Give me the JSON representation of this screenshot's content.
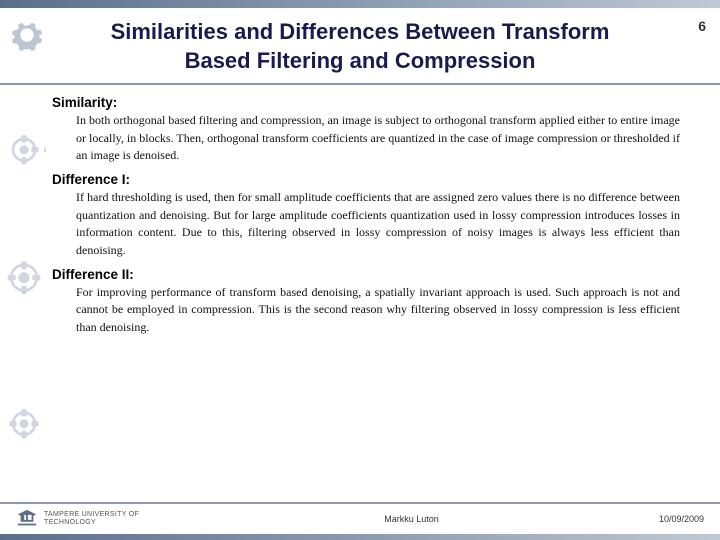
{
  "slide": {
    "number": "6",
    "title_line1": "Similarities and Differences Between Transform",
    "title_line2": "Based Filtering and Compression"
  },
  "sections": {
    "similarity": {
      "title": "Similarity:",
      "body": "In both orthogonal based filtering and compression, an image is subject to orthogonal transform applied either to entire image or locally, in blocks. Then, orthogonal transform coefficients are quantized in the case of image compression or thresholded if an image is denoised."
    },
    "difference1": {
      "title": "Difference I:",
      "body": "If hard thresholding is used, then for small amplitude coefficients that are assigned zero values there is no difference between quantization and denoising. But for large amplitude coefficients quantization used in lossy compression introduces losses in information content. Due to this, filtering observed in lossy compression of noisy images is always less efficient than denoising."
    },
    "difference2": {
      "title": "Difference II:",
      "body": "For improving performance of transform based denoising, a spatially invariant approach is used. Such approach is not and cannot be employed in compression. This is the second reason why filtering observed in lossy compression is less efficient than denoising."
    }
  },
  "footer": {
    "institution": "TAMPERE UNIVERSITY OF TECHNOLOGY",
    "author": "Markku Luton",
    "date": "10/09/2009"
  }
}
